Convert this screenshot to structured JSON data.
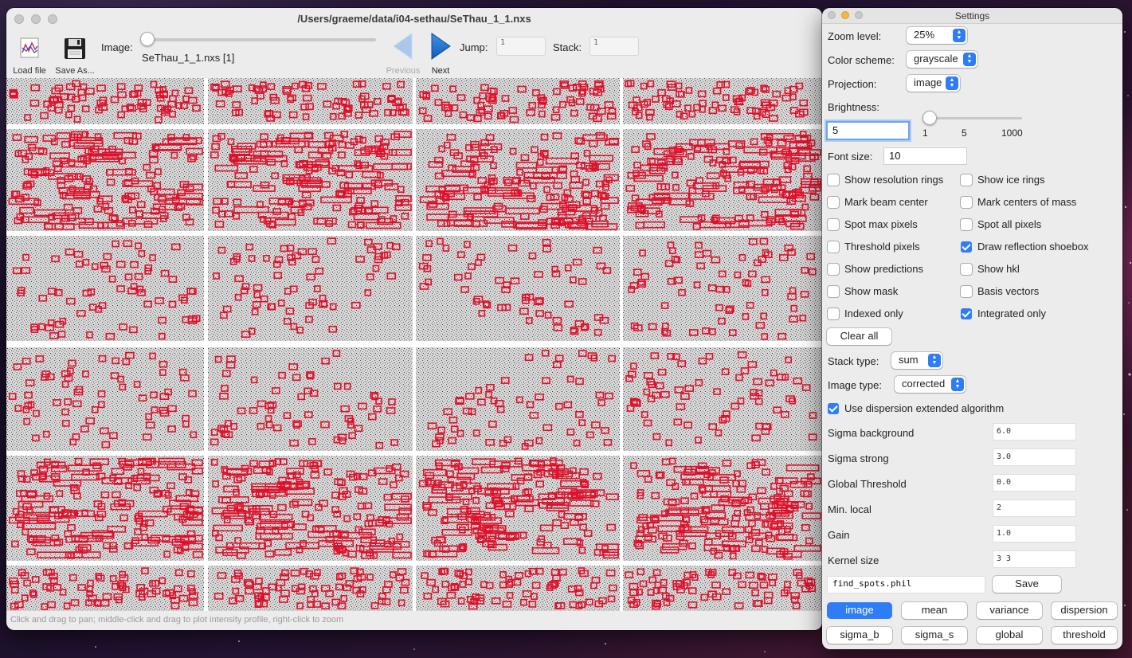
{
  "main_window": {
    "title": "/Users/graeme/data/i04-sethau/SeThau_1_1.nxs",
    "toolbar": {
      "load_file": "Load file",
      "save_as": "Save As...",
      "image_label": "Image:",
      "image_name": "SeThau_1_1.nxs [1]",
      "previous": "Previous",
      "next": "Next",
      "jump_label": "Jump:",
      "jump_value": "1",
      "stack_label": "Stack:",
      "stack_value": "1"
    },
    "status": "Click and drag to pan; middle-click and drag to plot intensity profile, right-click to zoom"
  },
  "settings": {
    "title": "Settings",
    "zoom_label": "Zoom level:",
    "zoom_value": "25%",
    "color_label": "Color scheme:",
    "color_value": "grayscale",
    "projection_label": "Projection:",
    "projection_value": "image",
    "brightness_label": "Brightness:",
    "brightness_value": "5",
    "brightness_ticks": [
      "1",
      "5",
      "1000"
    ],
    "font_label": "Font size:",
    "font_value": "10",
    "checkboxes": [
      {
        "label": "Show resolution rings",
        "checked": false
      },
      {
        "label": "Show ice rings",
        "checked": false
      },
      {
        "label": "Mark beam center",
        "checked": false
      },
      {
        "label": "Mark centers of mass",
        "checked": false
      },
      {
        "label": "Spot max pixels",
        "checked": false
      },
      {
        "label": "Spot all pixels",
        "checked": false
      },
      {
        "label": "Threshold pixels",
        "checked": false
      },
      {
        "label": "Draw reflection shoebox",
        "checked": true
      },
      {
        "label": "Show predictions",
        "checked": false
      },
      {
        "label": "Show hkl",
        "checked": false
      },
      {
        "label": "Show mask",
        "checked": false
      },
      {
        "label": "Basis vectors",
        "checked": false
      },
      {
        "label": "Indexed only",
        "checked": false
      },
      {
        "label": "Integrated only",
        "checked": true
      }
    ],
    "clear_all": "Clear all",
    "stack_type_label": "Stack type:",
    "stack_type_value": "sum",
    "image_type_label": "Image type:",
    "image_type_value": "corrected",
    "dispersion_label": "Use dispersion extended algorithm",
    "dispersion_checked": true,
    "params": [
      {
        "label": "Sigma background",
        "value": "6.0"
      },
      {
        "label": "Sigma strong",
        "value": "3.0"
      },
      {
        "label": "Global Threshold",
        "value": "0.0"
      },
      {
        "label": "Min. local",
        "value": "2"
      },
      {
        "label": "Gain",
        "value": "1.0"
      },
      {
        "label": "Kernel size",
        "value": "3 3"
      }
    ],
    "phil_file": "find_spots.phil",
    "save": "Save",
    "view_buttons": [
      "image",
      "mean",
      "variance",
      "dispersion",
      "sigma_b",
      "sigma_s",
      "global",
      "threshold"
    ],
    "active_view": "image"
  },
  "colors": {
    "accent": "#2f7df6",
    "shoebox": "#e0102a"
  }
}
